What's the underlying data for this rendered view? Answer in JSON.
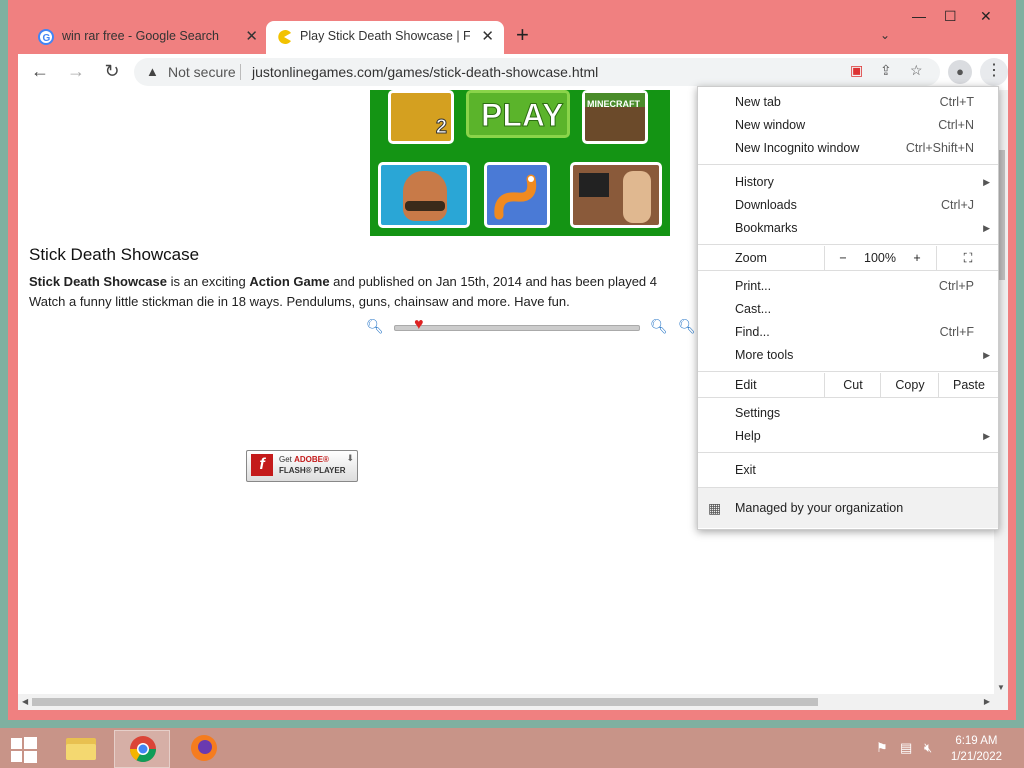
{
  "browser": {
    "tabs": [
      {
        "title": "win rar free - Google Search",
        "favicon": "google-icon",
        "active": false
      },
      {
        "title": "Play Stick Death Showcase | Free",
        "favicon": "pacman-icon",
        "active": true
      }
    ],
    "new_tab_label": "+",
    "window_controls": {
      "minimize": "—",
      "maximize": "☐",
      "close": "✕"
    },
    "address": {
      "security": "Not secure",
      "url": "justonlinegames.com/games/stick-death-showcase.html"
    }
  },
  "page": {
    "game_tiles": [
      {
        "name": "Temple Run 2",
        "label": "2"
      },
      {
        "name": "Play",
        "label": "PLAY"
      },
      {
        "name": "Minecraft",
        "label": "MINECRAFT"
      },
      {
        "name": "Clash Royale",
        "label": ""
      },
      {
        "name": "Slither",
        "label": ""
      },
      {
        "name": "GTA San Andreas",
        "label": ""
      }
    ],
    "title": "Stick Death Showcase",
    "desc_game": "Stick Death Showcase",
    "desc_part1": " is an exciting ",
    "desc_genre": "Action Game",
    "desc_part2": " and published on Jan 15th, 2014 and has been played 4",
    "desc_line2": "Watch a funny little stickman die in 18 ways. Pendulums, guns, chainsaw and more. Have fun.",
    "flash": {
      "line1_prefix": "Get ",
      "line1_brand": "ADOBE®",
      "line2": "FLASH® PLAYER"
    }
  },
  "menu": {
    "new_tab": {
      "label": "New tab",
      "shortcut": "Ctrl+T"
    },
    "new_window": {
      "label": "New window",
      "shortcut": "Ctrl+N"
    },
    "incognito": {
      "label": "New Incognito window",
      "shortcut": "Ctrl+Shift+N"
    },
    "history": {
      "label": "History"
    },
    "downloads": {
      "label": "Downloads",
      "shortcut": "Ctrl+J"
    },
    "bookmarks": {
      "label": "Bookmarks"
    },
    "zoom": {
      "label": "Zoom",
      "minus": "−",
      "value": "100%",
      "plus": "+"
    },
    "print": {
      "label": "Print...",
      "shortcut": "Ctrl+P"
    },
    "cast": {
      "label": "Cast..."
    },
    "find": {
      "label": "Find...",
      "shortcut": "Ctrl+F"
    },
    "more_tools": {
      "label": "More tools"
    },
    "edit": {
      "label": "Edit",
      "cut": "Cut",
      "copy": "Copy",
      "paste": "Paste"
    },
    "settings": {
      "label": "Settings"
    },
    "help": {
      "label": "Help"
    },
    "exit": {
      "label": "Exit"
    },
    "managed": {
      "label": "Managed by your organization"
    }
  },
  "taskbar": {
    "time": "6:19 AM",
    "date": "1/21/2022"
  },
  "colors": {
    "frame": "#f08080",
    "game_bg": "#149414",
    "taskbar": "#c89488"
  }
}
